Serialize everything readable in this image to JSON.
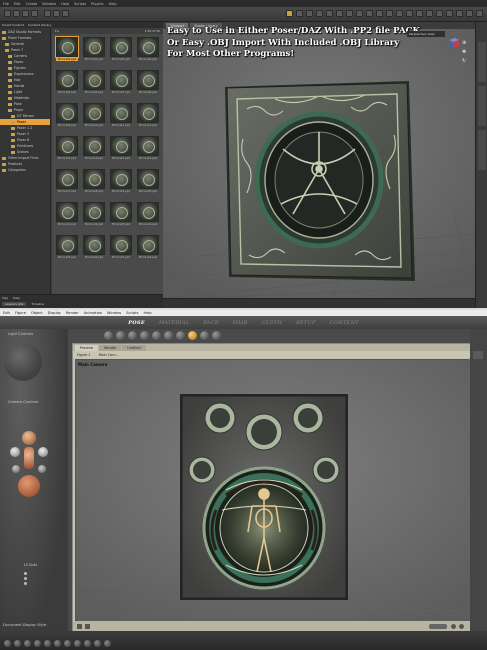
{
  "daz": {
    "menu": [
      "File",
      "Edit",
      "Create",
      "Window",
      "Help",
      "Scripts",
      "Plugins",
      "Help"
    ],
    "left_tabs": [
      "Smart Content",
      "Content Library"
    ],
    "tree": [
      {
        "label": "DAZ Studio Formats"
      },
      {
        "label": "Poser Formats"
      },
      {
        "label": "General"
      },
      {
        "label": "Poser 7"
      },
      {
        "label": "Camera"
      },
      {
        "label": "Faces"
      },
      {
        "label": "Figures"
      },
      {
        "label": "Expressions"
      },
      {
        "label": "Hair"
      },
      {
        "label": "Hands"
      },
      {
        "label": "Light"
      },
      {
        "label": "Materials"
      },
      {
        "label": "Pose"
      },
      {
        "label": "Props"
      },
      {
        "label": "DT Mirrors"
      },
      {
        "label": "Poser"
      },
      {
        "label": "Poser 1-2"
      },
      {
        "label": "Poser 5"
      },
      {
        "label": "Poser 6"
      },
      {
        "label": "Primitives"
      },
      {
        "label": "Scenes"
      },
      {
        "label": "Other Import Fmts"
      },
      {
        "label": "Products"
      },
      {
        "label": "Categories"
      }
    ],
    "grid_header_left": "▾ ▸",
    "grid_header_right": "1-30 of 30",
    "thumbs": [
      "Mirrors01.pp2",
      "Mirrors02.pp2",
      "Mirrors03.pp2",
      "Mirrors04.pp2",
      "Mirrors05.pp2",
      "Mirrors06.pp2",
      "Mirrors07.pp2",
      "Mirrors08.pp2",
      "Mirrors09.pp2",
      "Mirrors10.pp2",
      "Mirrors11.pp2",
      "Mirrors12.pp2",
      "Mirrors13.pp2",
      "Mirrors14.pp2",
      "Mirrors15.pp2",
      "Mirrors16.pp2",
      "Mirrors17.pp2",
      "Mirrors18.pp2",
      "Mirrors19.pp2",
      "Mirrors20.pp2",
      "Mirrors21.pp2",
      "Mirrors22.pp2",
      "Mirrors23.pp2",
      "Mirrors24.pp2",
      "Mirrors25.pp2",
      "Mirrors26.pp2",
      "Mirrors27.pp2",
      "Mirrors28.pp2"
    ],
    "left_bottom_tabs": [
      "Tips",
      "Help"
    ],
    "left_bottom_label": "Lessons Lite",
    "left_bottom_label2": "Timeline",
    "view_tabs": [
      "Viewport",
      "Shader Library"
    ],
    "persp_label": "Perspective View",
    "promo_lines": [
      "Easy to Use in Either Poser/DAZ With .PP2 file PACK",
      "Or Easy .OBJ Import With Included .OBJ Library",
      "For Most Other Programs!"
    ],
    "colors": {
      "accent": "#e6a23c",
      "viewport": "#6b6b6b",
      "frame": "#4d5a4a"
    }
  },
  "poser": {
    "menu": [
      "Edit",
      "Figure",
      "Object",
      "Display",
      "Render",
      "Animation",
      "Window",
      "Scripts",
      "Help"
    ],
    "room_tabs": [
      "POSE",
      "MATERIAL",
      "FACE",
      "HAIR",
      "CLOTH",
      "SETUP",
      "CONTENT"
    ],
    "active_room": "POSE",
    "light_controls_label": "Light Controls",
    "camera_controls_label": "Camera Controls",
    "ui_dots_label": "UI Dots",
    "document_display_label": "Document Display Style",
    "doc_tabs": [
      "Preview",
      "Render",
      "Untitled"
    ],
    "figure_select": "Figure 1",
    "camera_select": "Main Cam...",
    "camera_name": "Main Camera",
    "colors": {
      "doc_bg": "#c6c2b0",
      "viewport": "#6f6f6f"
    }
  }
}
